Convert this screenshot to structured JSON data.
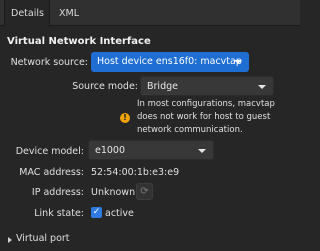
{
  "tabs": [
    {
      "label": "Details",
      "active": true
    },
    {
      "label": "XML",
      "active": false
    }
  ],
  "section_title": "Virtual Network Interface",
  "network_source": {
    "label": "Network source:",
    "value": "Host device ens16f0: macvtap"
  },
  "source_mode": {
    "label": "Source mode:",
    "value": "Bridge"
  },
  "warning": {
    "icon": "warning-icon",
    "text": "In most configurations, macvtap does not work for host to guest network communication."
  },
  "device_model": {
    "label": "Device model:",
    "value": "e1000"
  },
  "mac_address": {
    "label": "MAC address:",
    "value": "52:54:00:1b:e3:e9"
  },
  "ip_address": {
    "label": "IP address:",
    "value": "Unknown"
  },
  "link_state": {
    "label": "Link state:",
    "value": "active",
    "checked": true
  },
  "virtual_port": {
    "label": "Virtual port"
  },
  "colors": {
    "accent": "#1f6ed4",
    "warning": "#f0a30a",
    "background": "#262626"
  }
}
